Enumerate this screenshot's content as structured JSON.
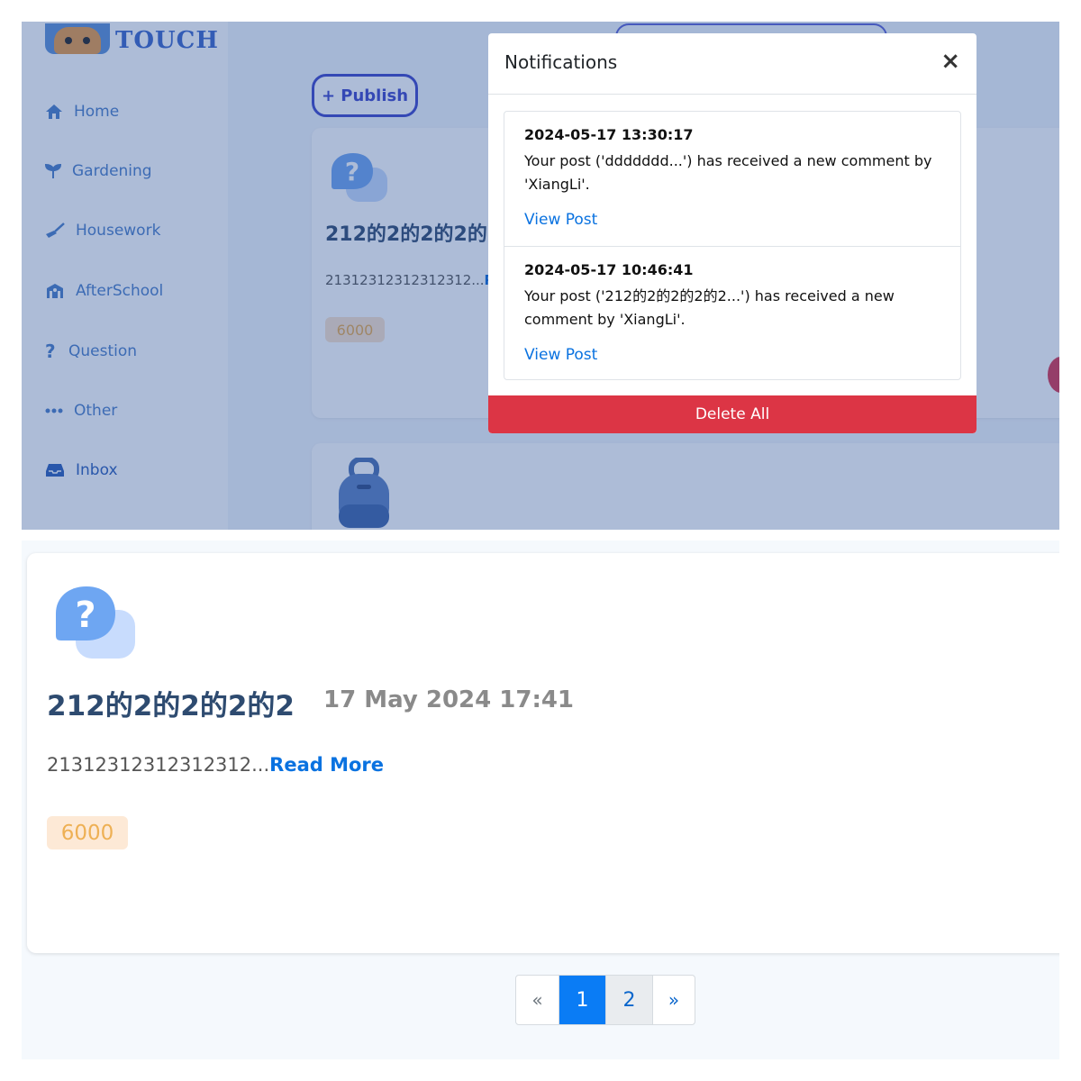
{
  "app": {
    "logo_text": "TOUCH"
  },
  "sidebar": {
    "items": [
      {
        "label": "Home",
        "icon": "home-icon"
      },
      {
        "label": "Gardening",
        "icon": "sprout-icon"
      },
      {
        "label": "Housework",
        "icon": "broom-icon"
      },
      {
        "label": "AfterSchool",
        "icon": "school-icon"
      },
      {
        "label": "Question",
        "icon": "question-icon"
      },
      {
        "label": "Other",
        "icon": "ellipsis-icon"
      },
      {
        "label": "Inbox",
        "icon": "inbox-icon"
      }
    ]
  },
  "main": {
    "publish_label": "+ Publish",
    "card_preview": {
      "title": "212的2的2的2的",
      "body": "21312312312312312...",
      "readmore": "R",
      "tag": "6000"
    }
  },
  "modal": {
    "title": "Notifications",
    "close_label": "×",
    "notifications": [
      {
        "time": "2024-05-17 13:30:17",
        "text": "Your post ('ddddddd...') has received a new comment by 'XiangLi'.",
        "link": "View Post"
      },
      {
        "time": "2024-05-17 10:46:41",
        "text": "Your post ('212的2的2的2的2...') has received a new comment by 'XiangLi'.",
        "link": "View Post"
      }
    ],
    "delete_all_label": "Delete All"
  },
  "post": {
    "title": "212的2的2的2的2",
    "date": "17 May 2024 17:41",
    "body": "21312312312312312...",
    "readmore": "Read More",
    "tag": "6000",
    "icon": "question-bubble-icon"
  },
  "pagination": {
    "prev": "«",
    "pages": [
      "1",
      "2"
    ],
    "active_page": "1",
    "next": "»"
  },
  "colors": {
    "accent": "#0a7cf5",
    "danger": "#dc3545",
    "publish": "#3d44c9",
    "title": "#2e4b70"
  }
}
